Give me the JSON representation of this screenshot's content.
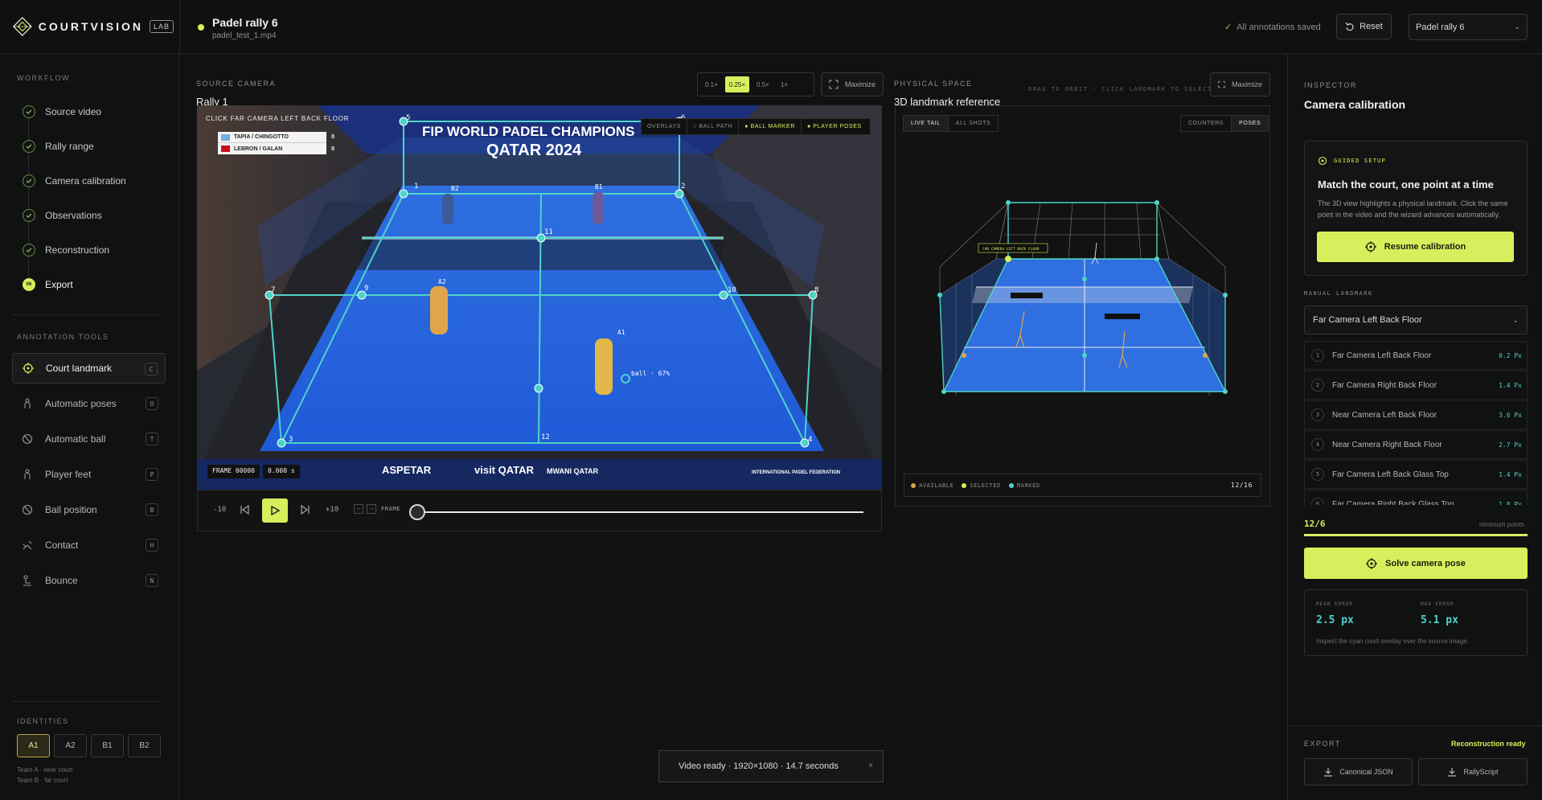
{
  "app": {
    "brand": "COURTVISION",
    "badge": "LAB"
  },
  "file": {
    "title": "Padel rally 6",
    "filename": "padel_test_1.mp4"
  },
  "header": {
    "saved": "All annotations saved",
    "reset": "Reset",
    "rally_select": "Padel rally 6"
  },
  "workflow": {
    "label": "WORKFLOW",
    "items": [
      {
        "label": "Source video"
      },
      {
        "label": "Rally range"
      },
      {
        "label": "Camera calibration"
      },
      {
        "label": "Observations"
      },
      {
        "label": "Reconstruction"
      },
      {
        "label": "Export",
        "badge": "06"
      }
    ]
  },
  "tools": {
    "label": "ANNOTATION TOOLS",
    "items": [
      {
        "label": "Court landmark",
        "key": "C",
        "icon": "crosshair-icon"
      },
      {
        "label": "Automatic poses",
        "key": "O",
        "icon": "person-icon"
      },
      {
        "label": "Automatic ball",
        "key": "T",
        "icon": "ball-icon"
      },
      {
        "label": "Player feet",
        "key": "P",
        "icon": "person-icon"
      },
      {
        "label": "Ball position",
        "key": "B",
        "icon": "ball-icon"
      },
      {
        "label": "Contact",
        "key": "H",
        "icon": "racket-icon"
      },
      {
        "label": "Bounce",
        "key": "N",
        "icon": "bounce-icon"
      }
    ]
  },
  "identities": {
    "label": "IDENTITIES",
    "items": [
      "A1",
      "A2",
      "B1",
      "B2"
    ],
    "notes": [
      "Team A · near court",
      "Team B · far court"
    ]
  },
  "source": {
    "label": "SOURCE CAMERA",
    "title": "Rally 1",
    "speeds": [
      "0.1×",
      "0.25×",
      "0.5×",
      "1×"
    ],
    "maximize": "Maximize",
    "instruction": "CLICK FAR CAMERA LEFT BACK FLOOR",
    "overlays": [
      "OVERLAYS",
      "○ BALL PATH",
      "● BALL MARKER",
      "● PLAYER POSES"
    ],
    "banner_title": "FIP WORLD PADEL CHAMPIONS",
    "banner_sub": "QATAR 2024",
    "scoreboard": [
      {
        "team": "TAPIA / CHINGOTTO",
        "score": "0"
      },
      {
        "team": "LEBRON / GALAN",
        "score": "0"
      }
    ],
    "player_labels": [
      "A1",
      "A2",
      "B1",
      "B2"
    ],
    "ball_label": "ball · 67%",
    "frame": "FRAME 00000",
    "time": "0.000 s",
    "ads": [
      "ASPETAR",
      "visit QATAR",
      "MWANI QATAR",
      "INTERNATIONAL PADEL FEDERATION"
    ],
    "transport": {
      "back10": "-10",
      "fwd10": "+10",
      "frame": "FRAME"
    }
  },
  "physical": {
    "label": "PHYSICAL SPACE",
    "title": "3D landmark reference",
    "hint": "DRAG TO ORBIT · CLICK LANDMARK TO SELECT",
    "maximize": "Maximize",
    "tabs_left": [
      "LIVE TAIL",
      "ALL SHOTS"
    ],
    "tabs_right": [
      "COUNTERS",
      "POSES"
    ],
    "tag": "FAR CAMERA LEFT BACK FLOOR",
    "legend": [
      "AVAILABLE",
      "SELECTED",
      "MARKED"
    ],
    "count": "12/16"
  },
  "inspector": {
    "label": "INSPECTOR",
    "title": "Camera calibration",
    "guided": {
      "label": "GUIDED SETUP",
      "heading": "Match the court, one point at a time",
      "body": "The 3D view highlights a physical landmark. Click the same point in the video and the wizard advances automatically.",
      "button": "Resume calibration"
    },
    "manual_label": "MANUAL LANDMARK",
    "manual_select": "Far Camera Left Back Floor",
    "landmarks": [
      {
        "n": "1",
        "name": "Far Camera Left Back Floor",
        "err": "0.2 Px"
      },
      {
        "n": "2",
        "name": "Far Camera Right Back Floor",
        "err": "1.4 Px"
      },
      {
        "n": "3",
        "name": "Near Camera Left Back Floor",
        "err": "3.6 Px"
      },
      {
        "n": "4",
        "name": "Near Camera Right Back Floor",
        "err": "2.7 Px"
      },
      {
        "n": "5",
        "name": "Far Camera Left Back Glass Top",
        "err": "1.4 Px"
      },
      {
        "n": "6",
        "name": "Far Camera Right Back Glass Top",
        "err": "1.8 Px"
      }
    ],
    "points": "12/6",
    "points_note": "minimum points",
    "points_progress": 1.0,
    "solve": "Solve camera pose",
    "mean_error_label": "MEAN ERROR",
    "mean_error": "2.5 px",
    "max_error_label": "MAX ERROR",
    "max_error": "5.1 px",
    "error_note": "Inspect the cyan court overlay over the source image.",
    "export_label": "EXPORT",
    "export_status": "Reconstruction ready",
    "export_buttons": [
      "Canonical JSON",
      "RallyScript"
    ]
  },
  "toast": {
    "message": "Video ready · 1920×1080 · 14.7 seconds",
    "close": "×"
  },
  "colors": {
    "accent": "#d7ef5c",
    "cyan": "#4ed3c9",
    "court": "#1e5bd6",
    "bg": "#101111"
  }
}
